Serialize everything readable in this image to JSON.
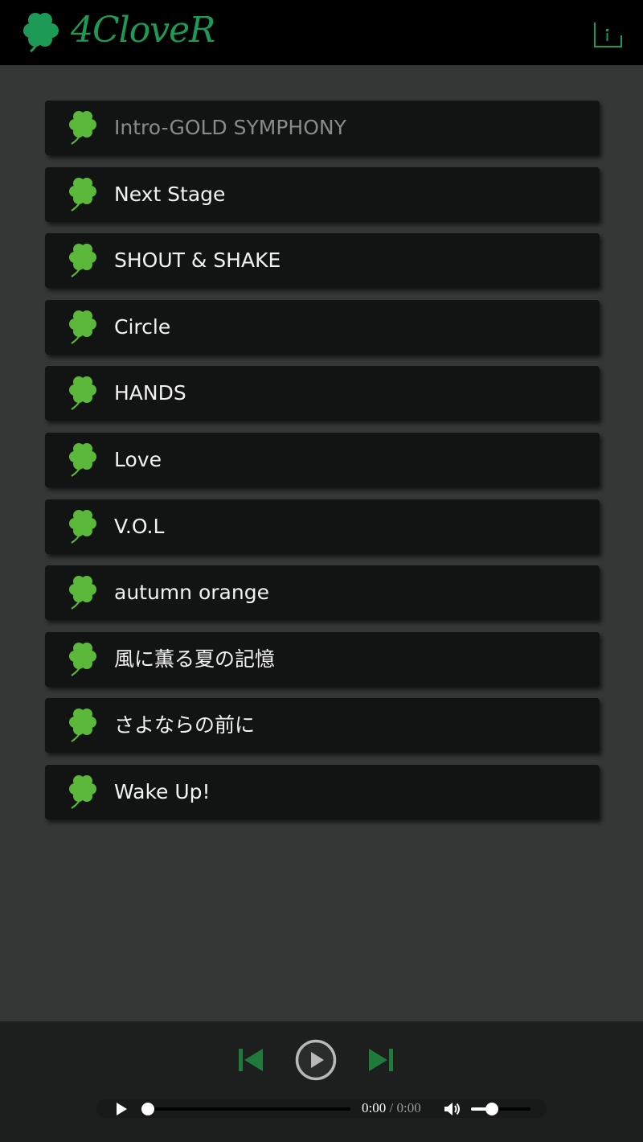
{
  "app": {
    "name": "4CloveR",
    "logo_icon": "clover-icon",
    "info_icon": "info-icon"
  },
  "colors": {
    "brand_green": "#1d9a55",
    "clover_green": "#5cb83a",
    "control_green": "#1f7a3b",
    "background": "#353736",
    "header": "#000000",
    "card": "#121413",
    "player": "#1c1f1e"
  },
  "tracks": [
    {
      "title": "Intro-GOLD SYMPHONY",
      "current": true
    },
    {
      "title": "Next Stage",
      "current": false
    },
    {
      "title": "SHOUT & SHAKE",
      "current": false
    },
    {
      "title": "Circle",
      "current": false
    },
    {
      "title": "HANDS",
      "current": false
    },
    {
      "title": "Love",
      "current": false
    },
    {
      "title": "V.O.L",
      "current": false
    },
    {
      "title": "autumn orange",
      "current": false
    },
    {
      "title": "風に薫る夏の記憶",
      "current": false
    },
    {
      "title": "さよならの前に",
      "current": false
    },
    {
      "title": "Wake Up!",
      "current": false
    }
  ],
  "player": {
    "prev_icon": "skip-previous-icon",
    "play_icon": "play-circle-icon",
    "next_icon": "skip-next-icon",
    "audio": {
      "current_time": "0:00",
      "separator": "/",
      "duration": "0:00",
      "progress": 0,
      "volume": 0.35
    }
  }
}
